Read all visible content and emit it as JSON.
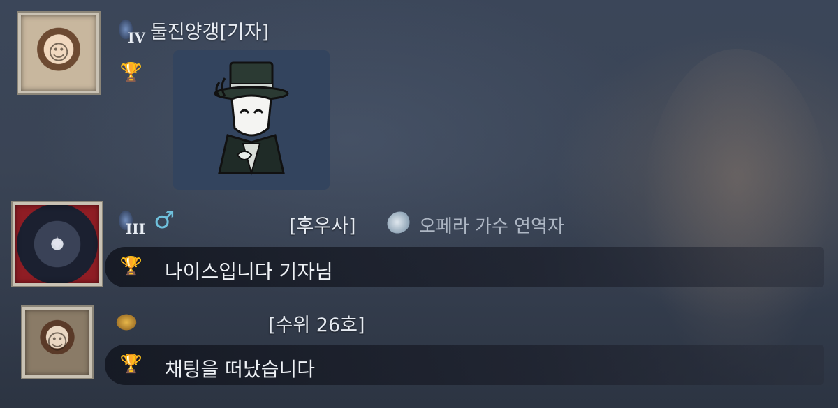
{
  "messages": [
    {
      "player_name": "둘진양갱[기자]",
      "rank_badge": "IV",
      "rank_icon": "tier-rank-icon",
      "trophy_icon": "trophy-icon",
      "avatar": "player-avatar",
      "sticker": "masked-top-hat-character-sticker"
    },
    {
      "player_name": "[후우사]",
      "rank_badge": "III",
      "rank_icon": "tier-rank-icon",
      "gender_symbol": "♂",
      "title_icon": "title-badge-icon",
      "title_text": "오페라 가수 연역자",
      "trophy_icon": "trophy-icon",
      "avatar": "player-avatar",
      "text": "나이스입니다 기자님"
    },
    {
      "player_name": "[수위 26호]",
      "rank_icon": "gold-rank-icon",
      "trophy_icon": "trophy-icon",
      "avatar": "player-avatar",
      "text": "채팅을 떠났습니다"
    }
  ],
  "colors": {
    "name_text": "#e6ebf2",
    "message_text": "#eef1f5",
    "gender": "#6fc0dc",
    "trophy": "#e0a77a",
    "title_text": "#aeb7c4"
  }
}
